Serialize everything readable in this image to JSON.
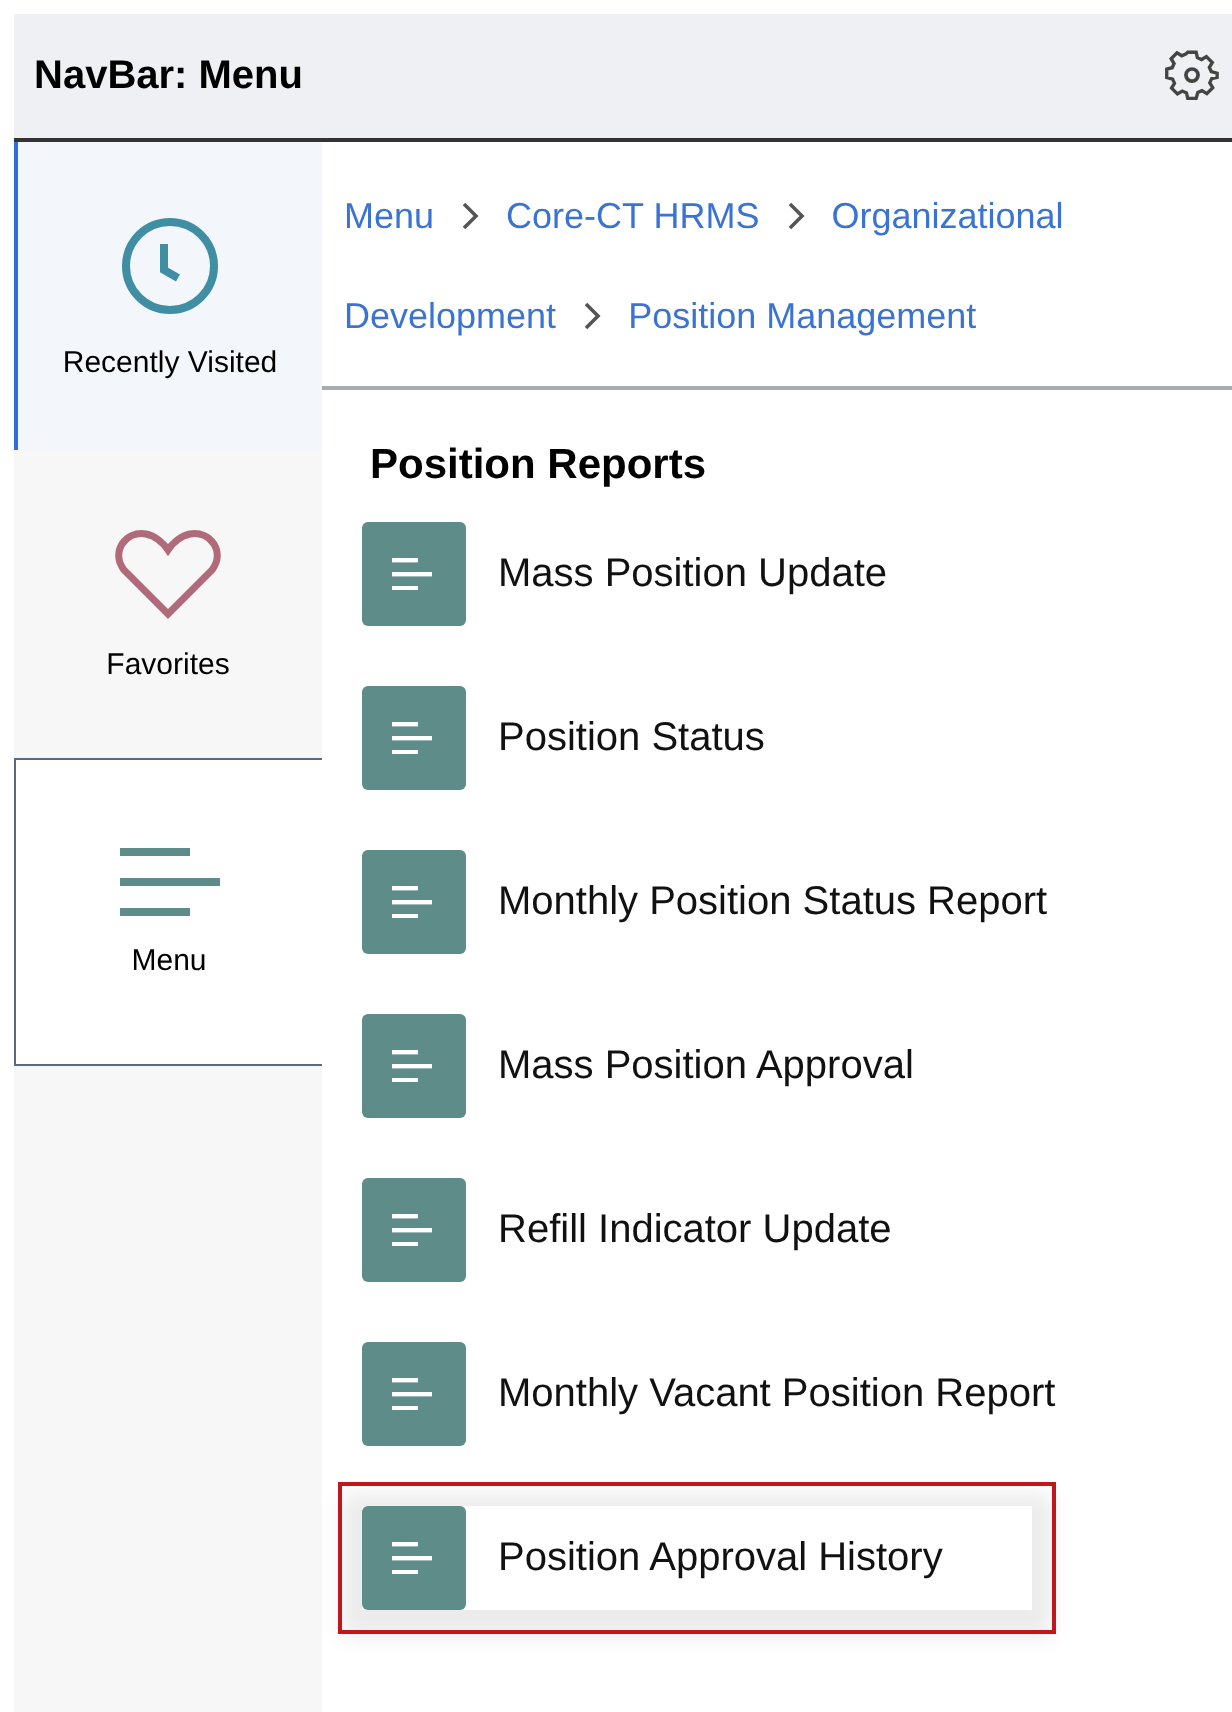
{
  "header": {
    "title": "NavBar: Menu"
  },
  "sidebar": {
    "tabs": [
      {
        "kind": "recent",
        "label": "Recently Visited",
        "selected": false
      },
      {
        "kind": "favorites",
        "label": "Favorites",
        "selected": false
      },
      {
        "kind": "menu",
        "label": "Menu",
        "selected": true
      }
    ]
  },
  "breadcrumb": {
    "lines": [
      [
        {
          "text": "Menu",
          "chevron_after": true
        },
        {
          "text": "Core-CT HRMS",
          "chevron_after": true
        },
        {
          "text": "Organizational",
          "chevron_after": false
        }
      ],
      [
        {
          "text": "Development",
          "chevron_after": true
        },
        {
          "text": "Position Management",
          "chevron_after": false
        }
      ]
    ]
  },
  "section": {
    "title": "Position Reports",
    "items": [
      {
        "label": "Mass Position Update",
        "highlighted": false
      },
      {
        "label": "Position Status",
        "highlighted": false
      },
      {
        "label": "Monthly Position Status Report",
        "highlighted": false
      },
      {
        "label": "Mass Position Approval",
        "highlighted": false
      },
      {
        "label": "Refill Indicator Update",
        "highlighted": false
      },
      {
        "label": "Monthly Vacant Position Report",
        "highlighted": false
      },
      {
        "label": "Position Approval History",
        "highlighted": true
      }
    ]
  }
}
